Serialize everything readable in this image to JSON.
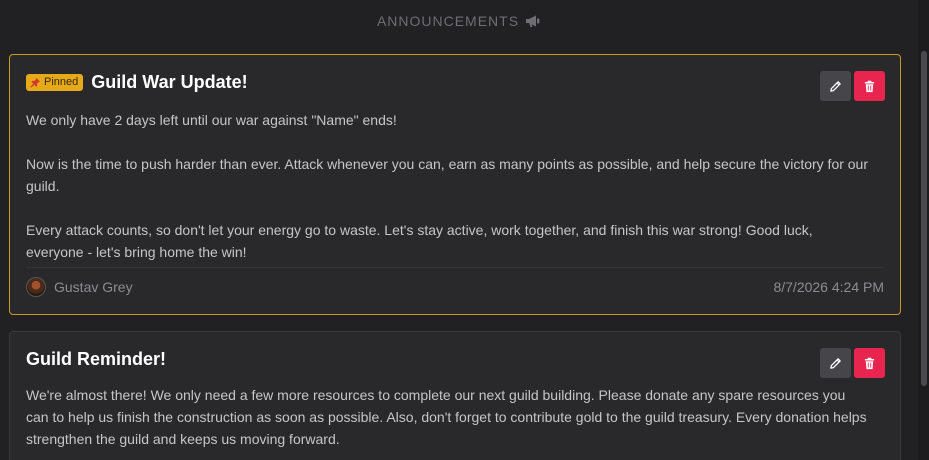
{
  "header": {
    "title": "ANNOUNCEMENTS",
    "icon": "megaphone-icon"
  },
  "colors": {
    "background": "#212123",
    "card": "#29292b",
    "pinned_border": "#c79a1f",
    "pin_badge": "#e6a919",
    "delete_button": "#e8254f",
    "edit_button": "#46464a"
  },
  "announcements": [
    {
      "pinned": true,
      "pinned_label": "Pinned",
      "title": "Guild War Update!",
      "paragraphs": [
        "We only have 2 days left until our war against \"Name\" ends!",
        "Now is the time to push harder than ever. Attack whenever you can, earn as many points as possible, and help secure the victory for our guild.",
        "Every attack counts, so don't let your energy go to waste. Let's stay active, work together, and finish this war strong! Good luck, everyone - let's bring home the win!"
      ],
      "author": "Gustav Grey",
      "timestamp": "8/7/2026 4:24 PM"
    },
    {
      "pinned": false,
      "title": "Guild Reminder!",
      "paragraphs": [
        "We're almost there! We only need a few more resources to complete our next guild building. Please donate any spare resources you can to help us finish the construction as soon as possible. Also, don't forget to contribute gold to the guild treasury. Every donation helps strengthen the guild and keeps us moving forward."
      ]
    }
  ]
}
